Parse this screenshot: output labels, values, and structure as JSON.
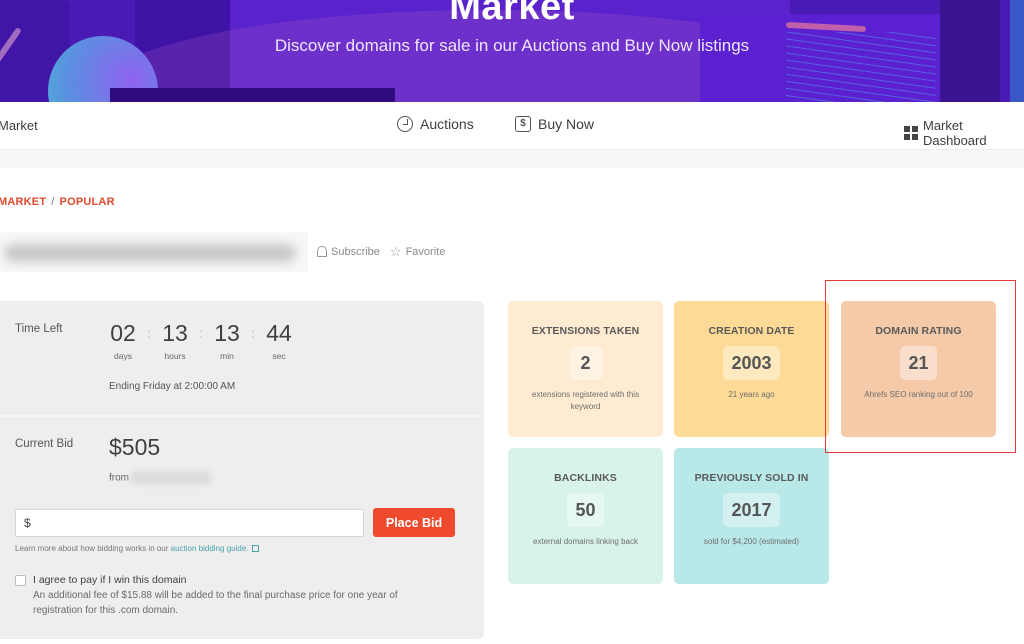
{
  "hero": {
    "title": "Market",
    "subtitle": "Discover domains for sale in our Auctions and Buy Now listings"
  },
  "nav": {
    "brand": "Market",
    "items": [
      {
        "label": "Auctions",
        "icon": "auction-clock-icon"
      },
      {
        "label": "Buy Now",
        "icon": "dollar-icon"
      },
      {
        "label": "Market Dashboard",
        "icon": "dashboard-grid-icon"
      }
    ]
  },
  "breadcrumb": {
    "items": [
      "MARKET",
      "POPULAR"
    ],
    "separator": "/"
  },
  "domain": {
    "actions": {
      "subscribe": "Subscribe",
      "favorite": "Favorite"
    }
  },
  "auction": {
    "time_left_label": "Time Left",
    "countdown": [
      {
        "value": "02",
        "unit": "days"
      },
      {
        "value": "13",
        "unit": "hours"
      },
      {
        "value": "13",
        "unit": "min"
      },
      {
        "value": "44",
        "unit": "sec"
      }
    ],
    "separator": ":",
    "ending": "Ending Friday at 2:00:00 AM",
    "current_bid_label": "Current Bid",
    "current_bid": "$505",
    "from_label": "from",
    "bid_input_value": "$",
    "place_bid_label": "Place Bid",
    "learn_text": "Learn more about how bidding works in our ",
    "learn_link": "auction bidding guide.",
    "agree_label": "I agree to pay if I win this domain",
    "agree_note": "An additional fee of $15.88 will be added to the final purchase price for one year of registration for this .com domain."
  },
  "stats": [
    {
      "title": "EXTENSIONS TAKEN",
      "value": "2",
      "desc": "extensions registered with this keyword",
      "color": "#feebd1"
    },
    {
      "title": "CREATION DATE",
      "value": "2003",
      "desc": "21 years ago",
      "color": "#fdda95"
    },
    {
      "title": "DOMAIN RATING",
      "value": "21",
      "desc": "Ahrefs SEO ranking out of 100",
      "color": "#f5caa8"
    },
    {
      "title": "BACKLINKS",
      "value": "50",
      "desc": "external domains linking back",
      "color": "#d8f4e8"
    },
    {
      "title": "PREVIOUSLY SOLD IN",
      "value": "2017",
      "desc": "sold for $4,200 (estimated)",
      "color": "#b8e8e8"
    }
  ],
  "colors": {
    "accent": "#ef4a2e",
    "breadcrumb": "#e2492d",
    "link": "#4aa3a9",
    "highlight_box": "#e33a3a",
    "hero_bg": "#4a1ab5"
  }
}
